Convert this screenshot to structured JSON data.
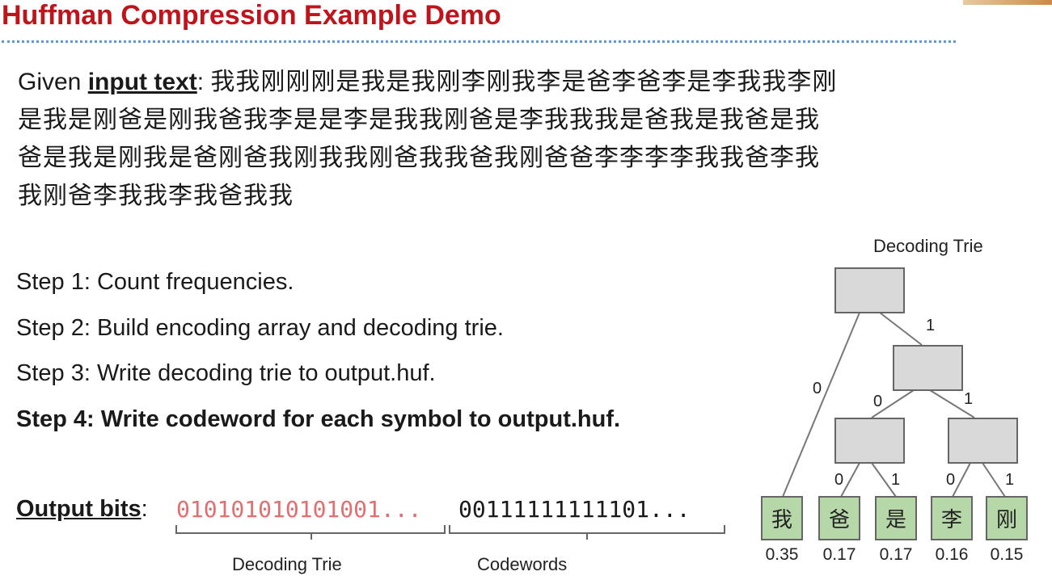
{
  "title": "Huffman Compression Example Demo",
  "input": {
    "prefix": "Given ",
    "label": "input text",
    "colon": ": ",
    "line1": "我我刚刚刚是我是我刚李刚我李是爸李爸李是李我我李刚",
    "line2": "是我是刚爸是刚我爸我李是是李是我我刚爸是李我我我是爸我是我爸是我",
    "line3": "爸是我是刚我是爸刚爸我刚我我刚爸我我爸我刚爸爸李李李李我我爸李我",
    "line4": "我刚爸李我我李我爸我我"
  },
  "steps": [
    "Step 1: Count frequencies.",
    "Step 2: Build encoding array and decoding trie.",
    "Step 3: Write decoding trie to output.huf.",
    "Step 4: Write codeword for each symbol to output.huf."
  ],
  "output": {
    "label": "Output bits",
    "colon": ": ",
    "trie_bits": "010101010101001...",
    "codeword_bits": "00111111111101...",
    "brace_label_trie": "Decoding Trie",
    "brace_label_codewords": "Codewords"
  },
  "trie": {
    "title": "Decoding Trie",
    "edge_labels": [
      "0",
      "1",
      "0",
      "1",
      "0",
      "1",
      "0",
      "1"
    ],
    "leaves": [
      {
        "symbol": "我",
        "freq": "0.35"
      },
      {
        "symbol": "爸",
        "freq": "0.17"
      },
      {
        "symbol": "是",
        "freq": "0.17"
      },
      {
        "symbol": "李",
        "freq": "0.16"
      },
      {
        "symbol": "刚",
        "freq": "0.15"
      }
    ]
  },
  "colors": {
    "title": "#c0141c",
    "dotted_rule": "#5b9bd5",
    "trie_bits": "#e07070",
    "internal_node": "#d9d9d9",
    "leaf_node": "#b6d7a8"
  }
}
